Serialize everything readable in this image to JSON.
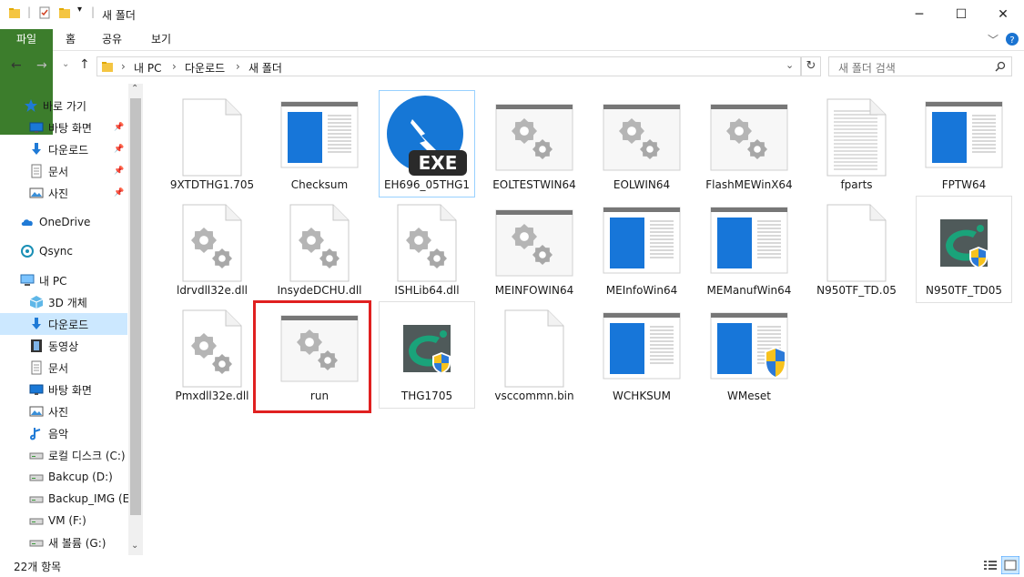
{
  "window": {
    "title": "새 폴더",
    "minimize": "─",
    "maximize": "☐",
    "close": "✕"
  },
  "ribbon": {
    "tabs": [
      "파일",
      "홈",
      "공유",
      "보기"
    ]
  },
  "address": {
    "path": [
      "내 PC",
      "다운로드",
      "새 폴더"
    ],
    "search_placeholder": "새 폴더 검색"
  },
  "nav": {
    "items": [
      {
        "label": "바로 가기",
        "icon": "star-icon",
        "pinned": false,
        "selected": false
      },
      {
        "label": "바탕 화면",
        "icon": "desktop-icon",
        "pinned": true,
        "selected": false
      },
      {
        "label": "다운로드",
        "icon": "download-icon",
        "pinned": true,
        "selected": false
      },
      {
        "label": "문서",
        "icon": "document-icon",
        "pinned": true,
        "selected": false
      },
      {
        "label": "사진",
        "icon": "picture-icon",
        "pinned": true,
        "selected": false
      },
      {
        "label": "OneDrive",
        "icon": "cloud-icon",
        "pinned": false,
        "selected": false
      },
      {
        "label": "Qsync",
        "icon": "sync-icon",
        "pinned": false,
        "selected": false
      },
      {
        "label": "내 PC",
        "icon": "pc-icon",
        "pinned": false,
        "selected": false
      },
      {
        "label": "3D 개체",
        "icon": "3d-icon",
        "pinned": false,
        "selected": false
      },
      {
        "label": "다운로드",
        "icon": "download-icon",
        "pinned": false,
        "selected": true
      },
      {
        "label": "동영상",
        "icon": "video-icon",
        "pinned": false,
        "selected": false
      },
      {
        "label": "문서",
        "icon": "document-icon",
        "pinned": false,
        "selected": false
      },
      {
        "label": "바탕 화면",
        "icon": "desktop-icon",
        "pinned": false,
        "selected": false
      },
      {
        "label": "사진",
        "icon": "picture-icon",
        "pinned": false,
        "selected": false
      },
      {
        "label": "음악",
        "icon": "music-icon",
        "pinned": false,
        "selected": false
      },
      {
        "label": "로컬 디스크 (C:)",
        "icon": "drive-icon",
        "pinned": false,
        "selected": false
      },
      {
        "label": "Bakcup (D:)",
        "icon": "drive-icon",
        "pinned": false,
        "selected": false
      },
      {
        "label": "Backup_IMG (E:)",
        "icon": "drive-icon",
        "pinned": false,
        "selected": false
      },
      {
        "label": "VM (F:)",
        "icon": "drive-icon",
        "pinned": false,
        "selected": false
      },
      {
        "label": "새 볼륨 (G:)",
        "icon": "drive-icon",
        "pinned": false,
        "selected": false
      }
    ]
  },
  "files": [
    {
      "name": "9XTDTHG1.705",
      "type": "blank"
    },
    {
      "name": "Checksum",
      "type": "window"
    },
    {
      "name": "EH696_05THG1",
      "type": "exe"
    },
    {
      "name": "EOLTESTWIN64",
      "type": "gearwin"
    },
    {
      "name": "EOLWIN64",
      "type": "gearwin"
    },
    {
      "name": "FlashMEWinX64",
      "type": "gearwin"
    },
    {
      "name": "fparts",
      "type": "text"
    },
    {
      "name": "FPTW64",
      "type": "window"
    },
    {
      "name": "ldrvdll32e.dll",
      "type": "geardoc"
    },
    {
      "name": "InsydeDCHU.dll",
      "type": "geardoc"
    },
    {
      "name": "ISHLib64.dll",
      "type": "geardoc"
    },
    {
      "name": "MEINFOWIN64",
      "type": "gearwin"
    },
    {
      "name": "MEInfoWin64",
      "type": "window"
    },
    {
      "name": "MEManufWin64",
      "type": "window"
    },
    {
      "name": "N950TF_TD.05",
      "type": "blank"
    },
    {
      "name": "N950TF_TD05",
      "type": "app"
    },
    {
      "name": "Pmxdll32e.dll",
      "type": "geardoc"
    },
    {
      "name": "run",
      "type": "gearwin"
    },
    {
      "name": "THG1705",
      "type": "app"
    },
    {
      "name": "vsccommn.bin",
      "type": "blank"
    },
    {
      "name": "WCHKSUM",
      "type": "window"
    },
    {
      "name": "WMeset",
      "type": "windowshield"
    }
  ],
  "exe_badge": "EXE",
  "status": {
    "count": "22개 항목"
  }
}
